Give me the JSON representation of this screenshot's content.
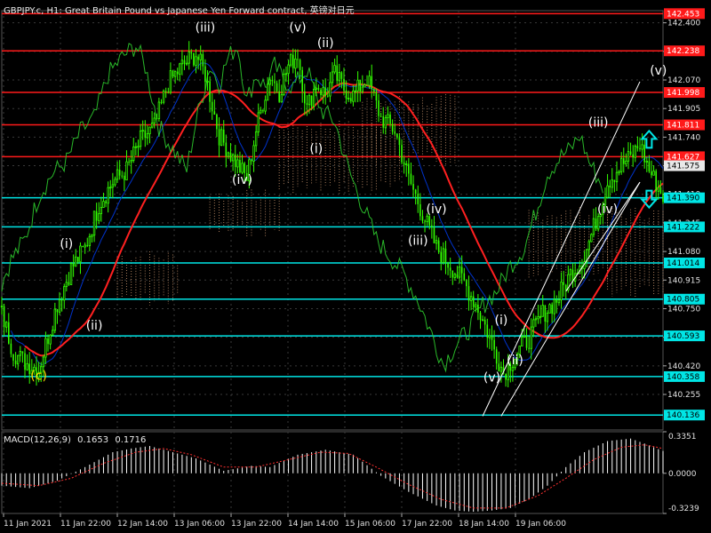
{
  "header": {
    "title": "GBPJPY.c, H1:  Great Britain Pound vs Japanese Yen Forward contract, 英镑对日元"
  },
  "macd": {
    "label": "MACD(12,26,9)",
    "value_main": "0.1653",
    "value_signal": "0.1716",
    "axis_labels": [
      "0.3351",
      "0.0000",
      "-0.3239"
    ]
  },
  "chart_data": [
    {
      "type": "candlestick",
      "title": "GBPJPY.c, H1:  Great Britain Pound vs Japanese Yen Forward contract, 英镑对日元",
      "background": "#000000",
      "grid": true,
      "ylim": [
        140.05,
        142.47
      ],
      "y_ticks": [
        "142.400",
        "142.235",
        "142.070",
        "141.905",
        "141.740",
        "141.575",
        "141.410",
        "141.245",
        "141.080",
        "140.915",
        "140.750",
        "140.585",
        "140.420",
        "140.255"
      ],
      "x_ticks": [
        "11 Jan 2021",
        "11 Jan 22:00",
        "12 Jan 14:00",
        "13 Jan 06:00",
        "13 Jan 22:00",
        "14 Jan 14:00",
        "15 Jan 06:00",
        "17 Jan 22:00",
        "18 Jan 14:00",
        "19 Jan 06:00"
      ],
      "price_series": {
        "name": "GBPJPY.c close",
        "color": "#32ff00",
        "anchors": [
          [
            0,
            140.72
          ],
          [
            5,
            140.5
          ],
          [
            10,
            140.44
          ],
          [
            16,
            140.4
          ],
          [
            24,
            140.78
          ],
          [
            30,
            140.98
          ],
          [
            36,
            141.1
          ],
          [
            42,
            141.35
          ],
          [
            48,
            141.48
          ],
          [
            54,
            141.55
          ],
          [
            60,
            141.72
          ],
          [
            66,
            141.8
          ],
          [
            72,
            142.05
          ],
          [
            78,
            142.15
          ],
          [
            84,
            142.22
          ],
          [
            88,
            142.1
          ],
          [
            94,
            141.75
          ],
          [
            100,
            141.62
          ],
          [
            106,
            141.5
          ],
          [
            110,
            141.78
          ],
          [
            116,
            142.1
          ],
          [
            120,
            142.0
          ],
          [
            124,
            142.15
          ],
          [
            128,
            142.22
          ],
          [
            132,
            141.9
          ],
          [
            136,
            142.05
          ],
          [
            140,
            141.98
          ],
          [
            144,
            142.1
          ],
          [
            148,
            142.02
          ],
          [
            152,
            141.98
          ],
          [
            158,
            142.08
          ],
          [
            164,
            141.85
          ],
          [
            170,
            141.78
          ],
          [
            176,
            141.5
          ],
          [
            182,
            141.3
          ],
          [
            188,
            141.1
          ],
          [
            194,
            141.0
          ],
          [
            200,
            140.9
          ],
          [
            206,
            140.75
          ],
          [
            212,
            140.55
          ],
          [
            217,
            140.38
          ],
          [
            222,
            140.48
          ],
          [
            228,
            140.58
          ],
          [
            234,
            140.72
          ],
          [
            240,
            140.8
          ],
          [
            246,
            140.95
          ],
          [
            252,
            141.05
          ],
          [
            258,
            141.3
          ],
          [
            262,
            141.48
          ],
          [
            268,
            141.58
          ],
          [
            272,
            141.62
          ],
          [
            276,
            141.7
          ],
          [
            280,
            141.55
          ],
          [
            284,
            141.45
          ],
          [
            286,
            141.4
          ]
        ]
      },
      "horizontal_levels": [
        {
          "value": "142.453",
          "color": "#ff1a1a"
        },
        {
          "value": "142.238",
          "color": "#ff1a1a"
        },
        {
          "value": "141.998",
          "color": "#ff1a1a"
        },
        {
          "value": "141.811",
          "color": "#ff1a1a"
        },
        {
          "value": "141.627",
          "color": "#ff1a1a"
        },
        {
          "value": "141.390",
          "color": "#00e5e5"
        },
        {
          "value": "141.222",
          "color": "#00e5e5"
        },
        {
          "value": "141.014",
          "color": "#00e5e5"
        },
        {
          "value": "140.805",
          "color": "#00e5e5"
        },
        {
          "value": "140.593",
          "color": "#00e5e5"
        },
        {
          "value": "140.358",
          "color": "#00e5e5"
        },
        {
          "value": "140.136",
          "color": "#00e5e5"
        }
      ],
      "current_price": "141.575",
      "wave_labels": [
        {
          "text": "(c)",
          "x": 16,
          "y": 140.34,
          "color": "#ffd700"
        },
        {
          "text": "(i)",
          "x": 28,
          "y": 141.1,
          "color": "#ffffff"
        },
        {
          "text": "(ii)",
          "x": 40,
          "y": 140.63,
          "color": "#ffffff"
        },
        {
          "text": "(iii)",
          "x": 88,
          "y": 142.35,
          "color": "#ffffff"
        },
        {
          "text": "(iv)",
          "x": 104,
          "y": 141.47,
          "color": "#ffffff"
        },
        {
          "text": "(v)",
          "x": 128,
          "y": 142.35,
          "color": "#ffffff"
        },
        {
          "text": "(ii)",
          "x": 140,
          "y": 142.26,
          "color": "#ffffff"
        },
        {
          "text": "(i)",
          "x": 136,
          "y": 141.65,
          "color": "#ffffff"
        },
        {
          "text": "(iv)",
          "x": 188,
          "y": 141.3,
          "color": "#ffffff"
        },
        {
          "text": "(iii)",
          "x": 180,
          "y": 141.12,
          "color": "#ffffff"
        },
        {
          "text": "(v)",
          "x": 212,
          "y": 140.33,
          "color": "#ffffff"
        },
        {
          "text": "(i)",
          "x": 216,
          "y": 140.66,
          "color": "#ffffff"
        },
        {
          "text": "(ii)",
          "x": 222,
          "y": 140.43,
          "color": "#ffffff"
        },
        {
          "text": "(iii)",
          "x": 258,
          "y": 141.8,
          "color": "#ffffff"
        },
        {
          "text": "(iv)",
          "x": 262,
          "y": 141.3,
          "color": "#ffffff"
        },
        {
          "text": "(v)",
          "x": 284,
          "y": 142.1,
          "color": "#ffffff"
        }
      ],
      "arrows": [
        {
          "direction": "up",
          "x": 280,
          "y": 141.73,
          "color": "#00e5e5"
        },
        {
          "direction": "down",
          "x": 280,
          "y": 141.38,
          "color": "#00e5e5"
        }
      ],
      "channel_lines": [
        {
          "from": [
            208,
            140.13
          ],
          "to": [
            276,
            142.06
          ]
        },
        {
          "from": [
            216,
            140.13
          ],
          "to": [
            276,
            141.48
          ]
        },
        {
          "from": [
            244,
            140.85
          ],
          "to": [
            276,
            141.48
          ]
        }
      ],
      "indicator_colors": {
        "red_ma": "#ff2020",
        "blue_ma": "#0033cc",
        "green_lagging": "#2ecc2e",
        "ichimoku_cloud": "#c8956e",
        "channel": "#ffffff"
      }
    },
    {
      "type": "histogram",
      "name": "MACD(12,26,9)",
      "ylim": [
        -0.3239,
        0.3351
      ],
      "y_ticks": [
        "0.3351",
        "0.0000",
        "-0.3239"
      ],
      "bar_color": "#ffffff",
      "signal_color": "#ff3030",
      "hist_anchors": [
        [
          0,
          -0.1
        ],
        [
          12,
          -0.12
        ],
        [
          24,
          -0.06
        ],
        [
          36,
          0.05
        ],
        [
          48,
          0.17
        ],
        [
          56,
          0.2
        ],
        [
          64,
          0.22
        ],
        [
          72,
          0.18
        ],
        [
          84,
          0.12
        ],
        [
          96,
          0.02
        ],
        [
          108,
          0.06
        ],
        [
          116,
          0.05
        ],
        [
          128,
          0.15
        ],
        [
          140,
          0.19
        ],
        [
          152,
          0.15
        ],
        [
          164,
          -0.02
        ],
        [
          176,
          -0.15
        ],
        [
          188,
          -0.26
        ],
        [
          196,
          -0.3
        ],
        [
          204,
          -0.31
        ],
        [
          212,
          -0.3
        ],
        [
          220,
          -0.28
        ],
        [
          228,
          -0.21
        ],
        [
          236,
          -0.1
        ],
        [
          244,
          0.05
        ],
        [
          252,
          0.17
        ],
        [
          262,
          0.26
        ],
        [
          272,
          0.28
        ],
        [
          278,
          0.24
        ],
        [
          286,
          0.18
        ]
      ],
      "signal_anchors": [
        [
          0,
          -0.08
        ],
        [
          16,
          -0.1
        ],
        [
          30,
          -0.04
        ],
        [
          44,
          0.08
        ],
        [
          58,
          0.17
        ],
        [
          70,
          0.2
        ],
        [
          82,
          0.15
        ],
        [
          96,
          0.05
        ],
        [
          110,
          0.05
        ],
        [
          124,
          0.11
        ],
        [
          138,
          0.17
        ],
        [
          150,
          0.16
        ],
        [
          162,
          0.05
        ],
        [
          176,
          -0.09
        ],
        [
          190,
          -0.21
        ],
        [
          204,
          -0.28
        ],
        [
          218,
          -0.28
        ],
        [
          232,
          -0.18
        ],
        [
          244,
          -0.04
        ],
        [
          256,
          0.11
        ],
        [
          268,
          0.21
        ],
        [
          278,
          0.23
        ],
        [
          286,
          0.2
        ]
      ]
    }
  ]
}
